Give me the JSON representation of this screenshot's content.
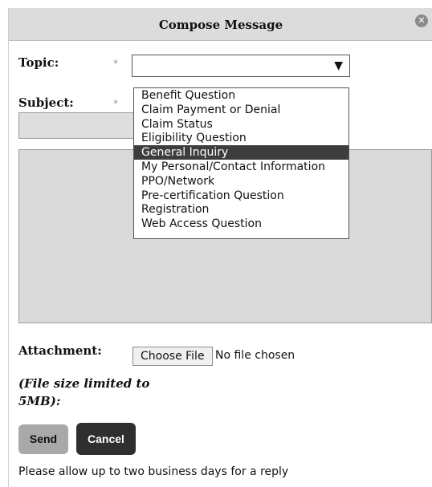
{
  "dialog": {
    "title": "Compose Message",
    "close_icon": "close-icon"
  },
  "form": {
    "topic_label": "Topic:",
    "subject_label": "Subject:",
    "required_marker": "*",
    "topic_value": "",
    "topic_options": [
      "Benefit Question",
      "Claim Payment or Denial",
      "Claim Status",
      "Eligibility Question",
      "General Inquiry",
      "My Personal/Contact Information",
      "PPO/Network",
      "Pre-certification Question",
      "Registration",
      "Web Access Question"
    ],
    "highlighted_option": "General Inquiry",
    "subject_value": "",
    "message_value": "",
    "attachment_label": "Attachment:",
    "choose_file_label": "Choose File",
    "file_status": "No file chosen",
    "file_size_note": "(File size limited to 5MB):"
  },
  "actions": {
    "send_label": "Send",
    "cancel_label": "Cancel"
  },
  "footer": {
    "note": "Please allow up to two business days for a reply"
  }
}
